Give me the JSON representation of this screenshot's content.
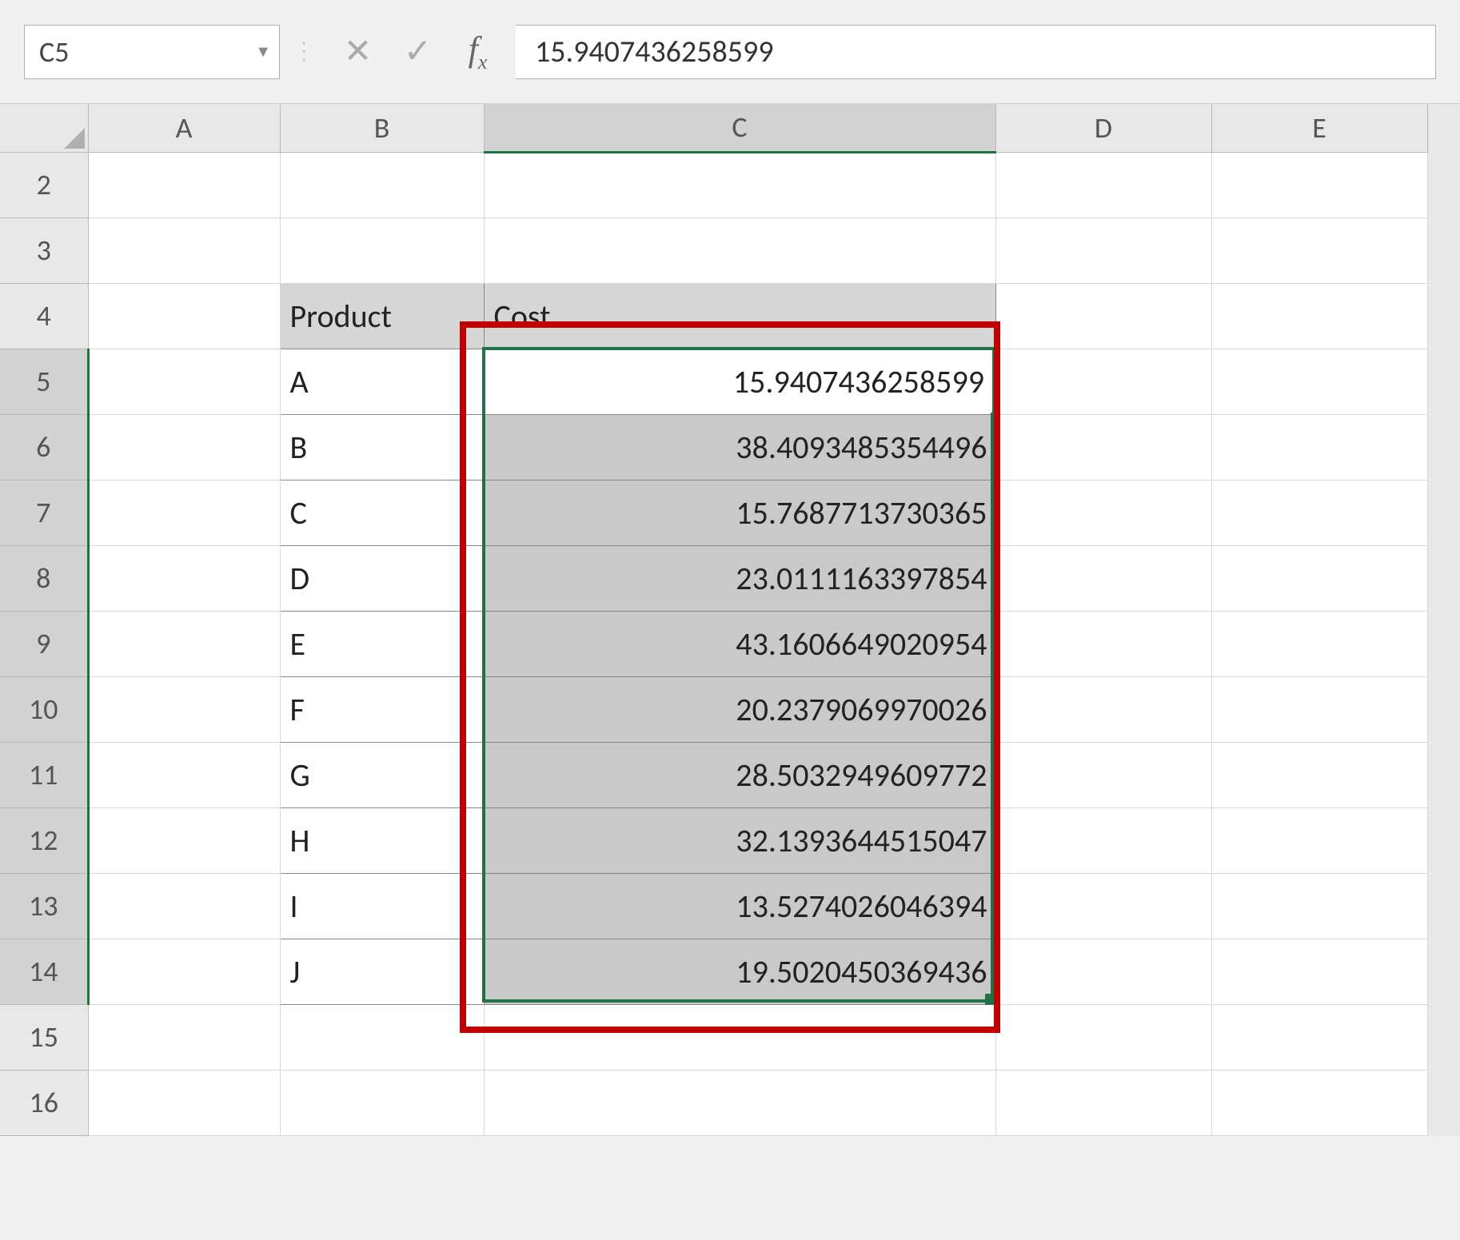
{
  "nameBox": "C5",
  "formulaValue": "15.9407436258599",
  "columns": [
    "A",
    "B",
    "C",
    "D",
    "E"
  ],
  "rows": [
    2,
    3,
    4,
    5,
    6,
    7,
    8,
    9,
    10,
    11,
    12,
    13,
    14,
    15,
    16
  ],
  "selectedColumn": "C",
  "selectedRows": [
    5,
    6,
    7,
    8,
    9,
    10,
    11,
    12,
    13,
    14
  ],
  "headers": {
    "product": "Product",
    "cost": "Cost"
  },
  "data": [
    {
      "product": "A",
      "cost": "15.9407436258599"
    },
    {
      "product": "B",
      "cost": "38.4093485354496"
    },
    {
      "product": "C",
      "cost": "15.7687713730365"
    },
    {
      "product": "D",
      "cost": "23.0111163397854"
    },
    {
      "product": "E",
      "cost": "43.1606649020954"
    },
    {
      "product": "F",
      "cost": "20.2379069970026"
    },
    {
      "product": "G",
      "cost": "28.5032949609772"
    },
    {
      "product": "H",
      "cost": "32.1393644515047"
    },
    {
      "product": "I",
      "cost": "13.5274026046394"
    },
    {
      "product": "J",
      "cost": "19.5020450369436"
    }
  ],
  "activeCellRow": 5,
  "tableStartRow": 4
}
